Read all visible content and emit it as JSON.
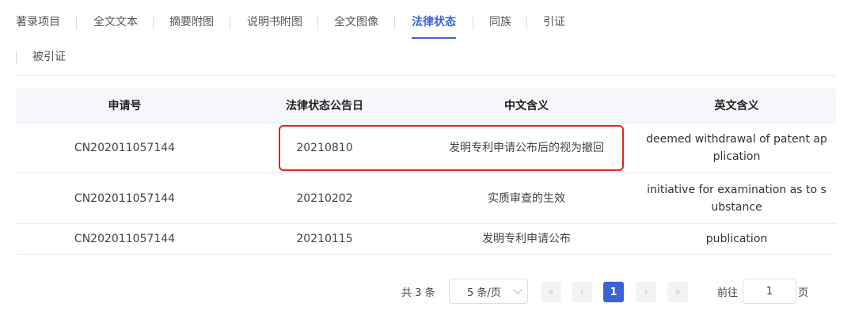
{
  "tabs": [
    {
      "label": "著录项目",
      "active": false
    },
    {
      "label": "全文文本",
      "active": false
    },
    {
      "label": "摘要附图",
      "active": false
    },
    {
      "label": "说明书附图",
      "active": false
    },
    {
      "label": "全文图像",
      "active": false
    },
    {
      "label": "法律状态",
      "active": true
    },
    {
      "label": "同族",
      "active": false
    },
    {
      "label": "引证",
      "active": false
    },
    {
      "label": "被引证",
      "active": false
    }
  ],
  "table": {
    "headers": [
      "申请号",
      "法律状态公告日",
      "中文含义",
      "英文含义"
    ],
    "rows": [
      {
        "app_no": "CN202011057144",
        "date": "20210810",
        "zh": "发明专利申请公布后的视为撤回",
        "en": "deemed withdrawal of patent application",
        "highlighted": true
      },
      {
        "app_no": "CN202011057144",
        "date": "20210202",
        "zh": "实质审查的生效",
        "en": "initiative for examination as to substance",
        "highlighted": false
      },
      {
        "app_no": "CN202011057144",
        "date": "20210115",
        "zh": "发明专利申请公布",
        "en": "publication",
        "highlighted": false
      }
    ]
  },
  "pagination": {
    "total_text": "共 3 条",
    "page_size": "5 条/页",
    "first_icon": "«",
    "prev_icon": "‹",
    "current_page": "1",
    "next_icon": "›",
    "last_icon": "»",
    "goto_label": "前往",
    "goto_value": "1",
    "page_suffix": "页"
  },
  "colors": {
    "accent": "#3a63d6",
    "highlight_border": "#e1251b",
    "header_bg": "#f5f7fa"
  }
}
